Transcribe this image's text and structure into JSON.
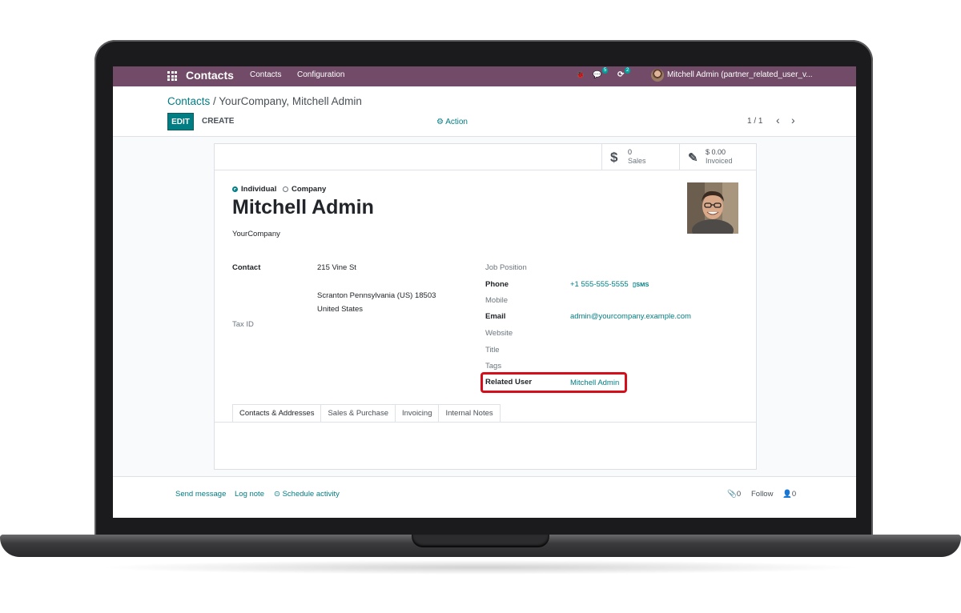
{
  "navbar": {
    "app_name": "Contacts",
    "menu": [
      "Contacts",
      "Configuration"
    ],
    "bug_icon": "🐞",
    "chat_icon": "💬",
    "chat_count": "5",
    "activity_icon": "⟳",
    "activity_count": "2",
    "user": "Mitchell Admin (partner_related_user_v..."
  },
  "breadcrumb": {
    "parent": "Contacts",
    "separator": " / ",
    "current": "YourCompany, Mitchell Admin"
  },
  "toolbar": {
    "edit": "EDIT",
    "create": "CREATE",
    "action": "⚙ Action"
  },
  "pager": {
    "value": "1 / 1",
    "prev": "‹",
    "next": "›"
  },
  "stats": [
    {
      "icon": "$",
      "value": "0",
      "label": "Sales"
    },
    {
      "icon": "✎",
      "value": "$ 0.00",
      "label": "Invoiced"
    }
  ],
  "company_type": {
    "individual": "Individual",
    "company": "Company",
    "selected": "Individual"
  },
  "partner": {
    "name": "Mitchell Admin",
    "company": "YourCompany"
  },
  "fields": {
    "contact_label": "Contact",
    "street": "215 Vine St",
    "city_line": "Scranton  Pennsylvania (US)  18503",
    "country": "United States",
    "tax_id_label": "Tax ID",
    "job_position_label": "Job Position",
    "phone_label": "Phone",
    "phone": "+1 555-555-5555",
    "sms": "SMS",
    "mobile_label": "Mobile",
    "email_label": "Email",
    "email": "admin@yourcompany.example.com",
    "website_label": "Website",
    "title_label": "Title",
    "tags_label": "Tags",
    "related_user_label": "Related User",
    "related_user": "Mitchell Admin"
  },
  "tabs": [
    "Contacts & Addresses",
    "Sales & Purchase",
    "Invoicing",
    "Internal Notes"
  ],
  "chatter": {
    "send_message": "Send message",
    "log_note": "Log note",
    "schedule_activity": "⊙ Schedule activity",
    "attachments": "📎0",
    "follow": "Follow",
    "followers": "👤0"
  },
  "colors": {
    "navbar": "#714b67",
    "accent": "#017e84",
    "highlight": "#d40f1b"
  }
}
